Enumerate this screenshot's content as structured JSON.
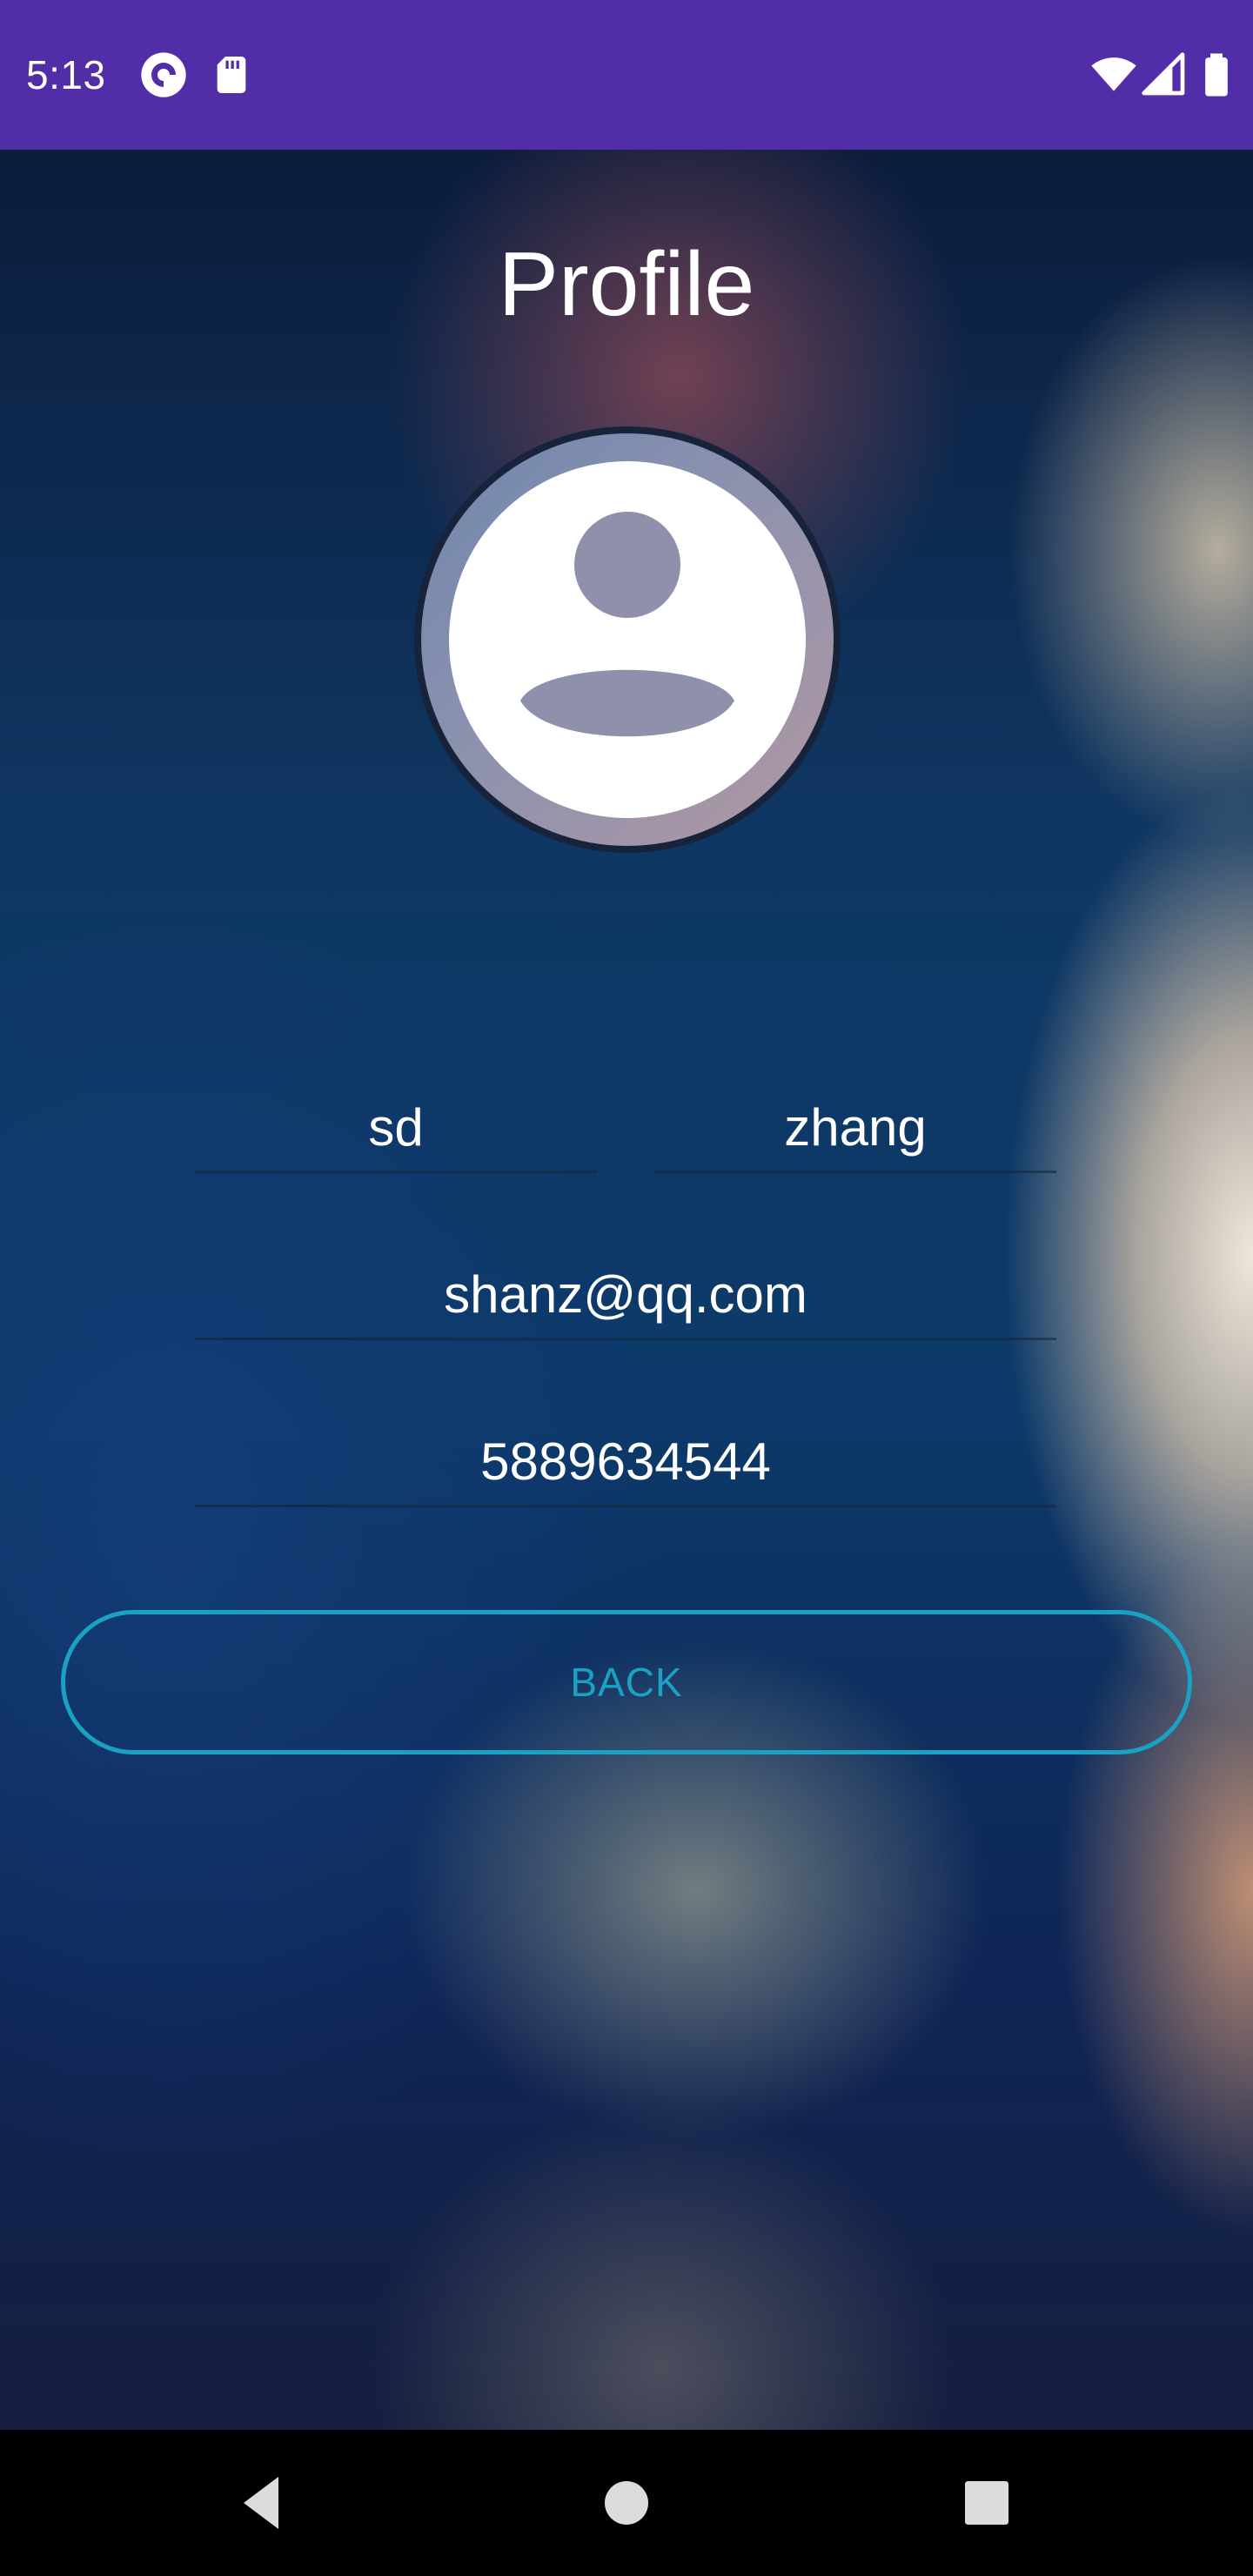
{
  "status_bar": {
    "time": "5:13",
    "icons_left": [
      "pocket-casts-icon",
      "sd-card-icon"
    ],
    "icons_right": [
      "wifi-icon",
      "cell-signal-icon",
      "battery-icon"
    ],
    "background_color": "#512DA8"
  },
  "profile": {
    "title": "Profile",
    "avatar_icon": "account-circle-icon",
    "first_name": "sd",
    "last_name": "zhang",
    "email": "shanz@qq.com",
    "phone": "5889634544",
    "back_label": "BACK",
    "accent_color": "#1AA2C4"
  },
  "nav_bar": {
    "buttons": [
      "back-icon",
      "home-icon",
      "recents-icon"
    ]
  }
}
